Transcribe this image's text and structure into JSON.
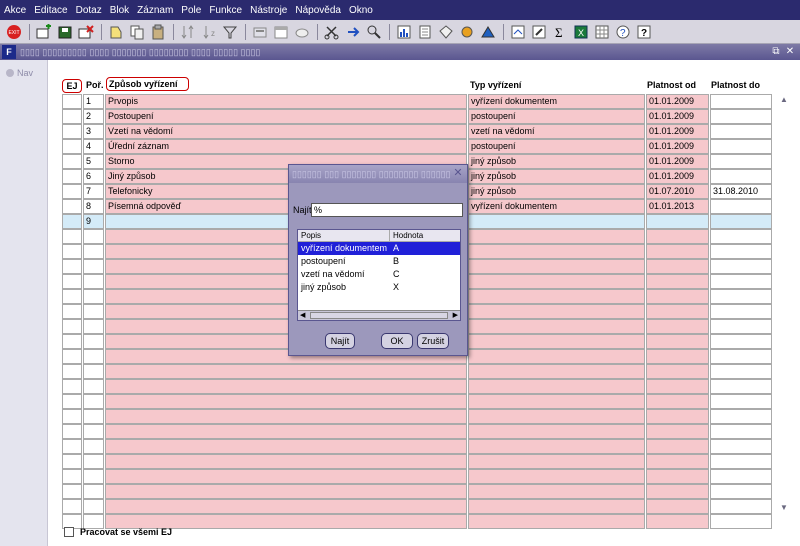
{
  "menu": [
    "Akce",
    "Editace",
    "Dotaz",
    "Blok",
    "Záznam",
    "Pole",
    "Funkce",
    "Nástroje",
    "Nápověda",
    "Okno"
  ],
  "toolbar_icons": [
    "exit-icon",
    "new-record-icon",
    "save-icon",
    "delete-icon",
    "print-icon",
    "copy-icon",
    "paste-icon",
    "clear-icon",
    "sort-icon",
    "sort-desc-icon",
    "filter-icon",
    "calc-icon",
    "calendar-icon",
    "attach-icon",
    "cut-icon",
    "find-icon",
    "spell-icon",
    "chart-icon",
    "document-icon",
    "diamond-icon",
    "hierarchy-icon",
    "triangle-icon",
    "form-icon",
    "edit-icon",
    "sum-icon",
    "excel-icon",
    "grid-icon",
    "help-icon",
    "context-help-icon"
  ],
  "nav": {
    "label": "Nav"
  },
  "grid": {
    "headers": {
      "ej": "EJ",
      "por": "Poř.",
      "zpusob": "Způsob vyřízení",
      "typ": "Typ vyřízení",
      "od": "Platnost od",
      "do": "Platnost do"
    },
    "rows": [
      {
        "por": "1",
        "zpusob": "Prvopis",
        "typ": "vyřízení dokumentem",
        "od": "01.01.2009",
        "do": ""
      },
      {
        "por": "2",
        "zpusob": "Postoupení",
        "typ": "postoupení",
        "od": "01.01.2009",
        "do": ""
      },
      {
        "por": "3",
        "zpusob": "Vzetí na vědomí",
        "typ": "vzetí na vědomí",
        "od": "01.01.2009",
        "do": ""
      },
      {
        "por": "4",
        "zpusob": "Úřední záznam",
        "typ": "postoupení",
        "od": "01.01.2009",
        "do": ""
      },
      {
        "por": "5",
        "zpusob": "Storno",
        "typ": "jiný způsob",
        "od": "01.01.2009",
        "do": ""
      },
      {
        "por": "6",
        "zpusob": "Jiný způsob",
        "typ": "jiný způsob",
        "od": "01.01.2009",
        "do": ""
      },
      {
        "por": "7",
        "zpusob": "Telefonicky",
        "typ": "jiný způsob",
        "od": "01.07.2010",
        "do": "31.08.2010"
      },
      {
        "por": "8",
        "zpusob": "Písemná odpověď",
        "typ": "vyřízení dokumentem",
        "od": "01.01.2013",
        "do": ""
      },
      {
        "por": "9",
        "zpusob": "",
        "typ": "",
        "od": "",
        "do": ""
      }
    ],
    "empty_rows": 20
  },
  "footer": {
    "checkbox_label": "Pracovat se všemi EJ"
  },
  "dialog": {
    "find_label": "Najít",
    "find_value": "%",
    "list_headers": {
      "popis": "Popis",
      "hodnota": "Hodnota"
    },
    "items": [
      {
        "popis": "vyřízení dokumentem",
        "hodnota": "A"
      },
      {
        "popis": "postoupení",
        "hodnota": "B"
      },
      {
        "popis": "vzetí na vědomí",
        "hodnota": "C"
      },
      {
        "popis": "jiný způsob",
        "hodnota": "X"
      }
    ],
    "selected_index": 0,
    "buttons": {
      "find": "Najít",
      "ok": "OK",
      "cancel": "Zrušit"
    }
  },
  "colors": {
    "menubar": "#2b2a6e",
    "required_field": "#f6c8cc",
    "current_row": "#d4ebf8",
    "selection": "#2020d8"
  }
}
